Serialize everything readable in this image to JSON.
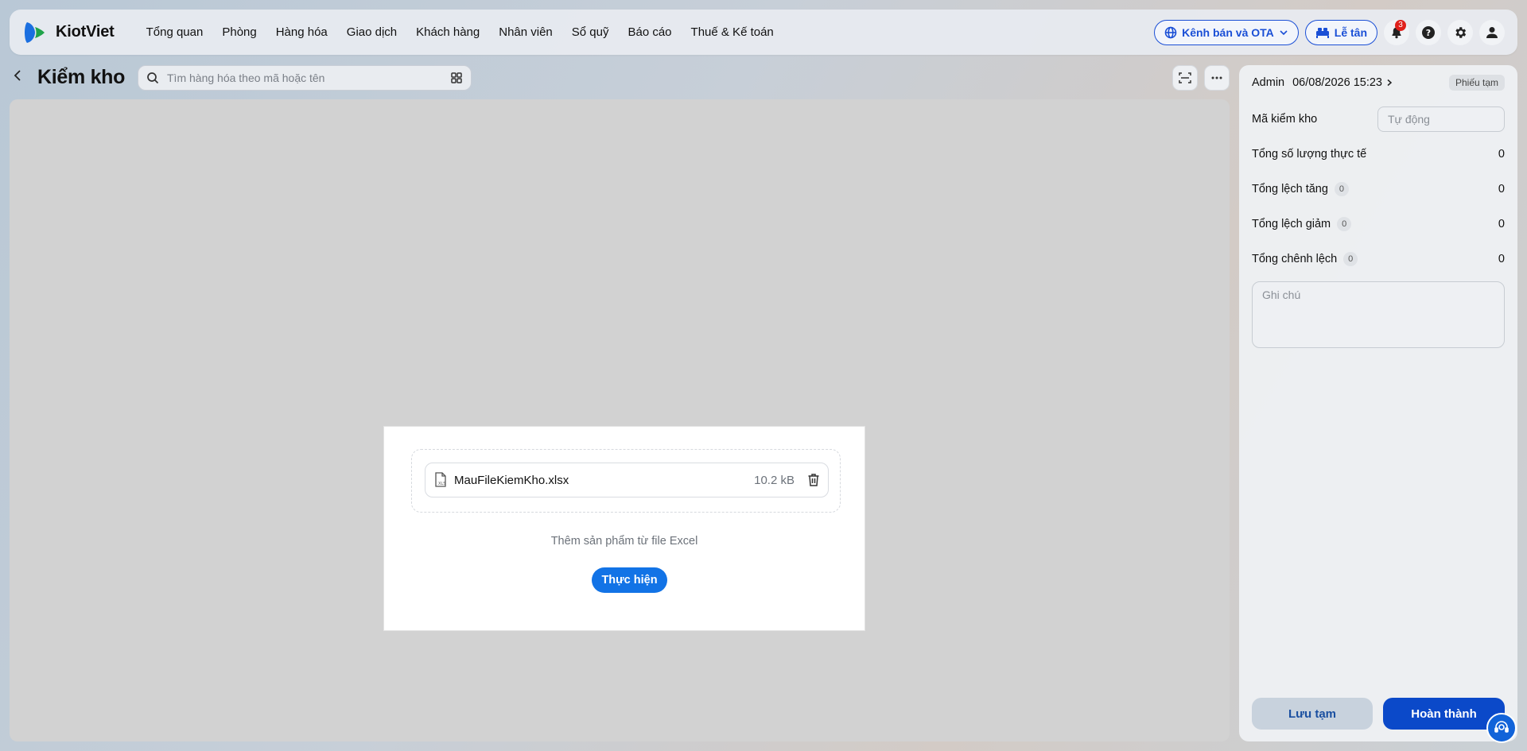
{
  "app": {
    "name": "KiotViet"
  },
  "nav": {
    "items": [
      {
        "label": "Tổng quan"
      },
      {
        "label": "Phòng"
      },
      {
        "label": "Hàng hóa"
      },
      {
        "label": "Giao dịch"
      },
      {
        "label": "Khách hàng"
      },
      {
        "label": "Nhân viên"
      },
      {
        "label": "Sổ quỹ"
      },
      {
        "label": "Báo cáo"
      },
      {
        "label": "Thuế & Kế toán"
      }
    ],
    "channel_label": "Kênh bán và OTA",
    "reception_label": "Lễ tân",
    "notification_count": "3"
  },
  "header": {
    "title": "Kiểm kho",
    "search_placeholder": "Tìm hàng hóa theo mã hoặc tên"
  },
  "import_dialog": {
    "file_name": "MauFileKiemKho.xlsx",
    "file_size": "10.2 kB",
    "hint": "Thêm sản phẩm từ file Excel",
    "action_label": "Thực hiện"
  },
  "panel": {
    "user": "Admin",
    "datetime": "06/08/2026 15:23",
    "status_tag": "Phiếu tạm",
    "code_label": "Mã kiểm kho",
    "code_placeholder": "Tự động",
    "total_actual_label": "Tổng số lượng thực tế",
    "total_actual_value": "0",
    "increase_label": "Tổng lệch tăng",
    "increase_count": "0",
    "increase_value": "0",
    "decrease_label": "Tổng lệch giảm",
    "decrease_count": "0",
    "decrease_value": "0",
    "diff_label": "Tổng chênh lệch",
    "diff_count": "0",
    "diff_value": "0",
    "note_placeholder": "Ghi chú",
    "save_draft_label": "Lưu tạm",
    "complete_label": "Hoàn thành"
  },
  "colors": {
    "primary": "#1273e6",
    "brand": "#0b49c9",
    "alert": "#e0201b"
  }
}
